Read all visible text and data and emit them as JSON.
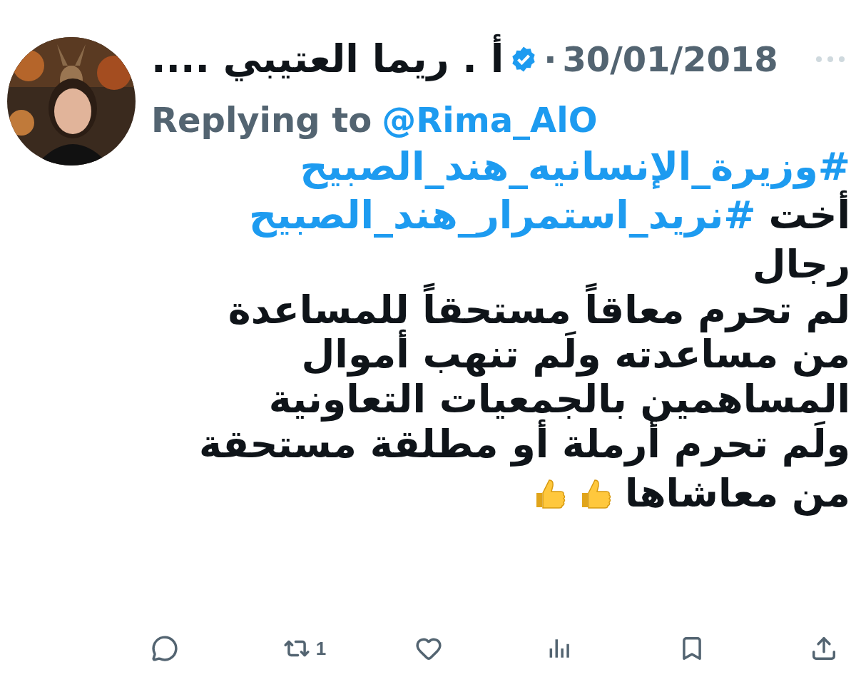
{
  "author": {
    "name": "أ . ريما العتيبي ....",
    "verified": true,
    "separator": "·",
    "date": "30/01/2018"
  },
  "reply": {
    "label": "Replying to",
    "handle": "@Rima_AlO"
  },
  "body": {
    "lines": [
      [
        {
          "kind": "hashtag",
          "text": "#وزيرة_الإنسانيه_هند_الصبيح"
        }
      ],
      [
        {
          "kind": "text",
          "text": "أخت"
        },
        {
          "kind": "hashtag",
          "text": "#نريد_استمرار_هند_الصبيح"
        }
      ],
      [
        {
          "kind": "text",
          "text": "رجال"
        }
      ],
      [
        {
          "kind": "text",
          "text": "لم تحرم معاقاً مستحقاً للمساعدة"
        }
      ],
      [
        {
          "kind": "text",
          "text": "من مساعدته ولَم تنهب أموال"
        }
      ],
      [
        {
          "kind": "text",
          "text": "المساهمين بالجمعيات التعاونية"
        }
      ],
      [
        {
          "kind": "text",
          "text": "ولَم تحرم أرملة أو مطلقة مستحقة"
        }
      ],
      [
        {
          "kind": "text",
          "text": "من معاشاها"
        },
        {
          "kind": "thumbs"
        },
        {
          "kind": "thumbs"
        }
      ]
    ]
  },
  "actions": [
    {
      "kind": "reply"
    },
    {
      "kind": "repost",
      "count": "1"
    },
    {
      "kind": "like"
    },
    {
      "kind": "views"
    },
    {
      "kind": "bookmark"
    },
    {
      "kind": "share"
    }
  ]
}
